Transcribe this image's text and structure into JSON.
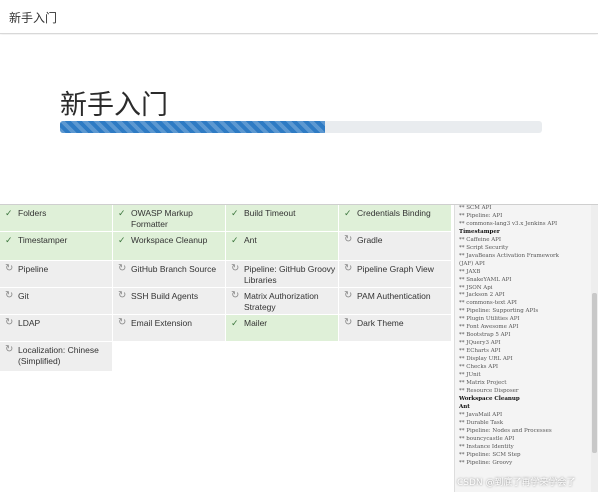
{
  "window": {
    "title": "新手入门"
  },
  "hero": {
    "title": "新手入门",
    "progress": 0.55
  },
  "plugins": [
    {
      "label": "Folders",
      "status": "installed",
      "icon": "check-icon"
    },
    {
      "label": "OWASP Markup Formatter",
      "status": "installed",
      "icon": "check-icon"
    },
    {
      "label": "Build Timeout",
      "status": "installed",
      "icon": "check-icon"
    },
    {
      "label": "Credentials Binding",
      "status": "installed",
      "icon": "check-icon"
    },
    {
      "label": "Timestamper",
      "status": "installed",
      "icon": "check-icon"
    },
    {
      "label": "Workspace Cleanup",
      "status": "installed",
      "icon": "check-icon"
    },
    {
      "label": "Ant",
      "status": "installed",
      "icon": "check-icon"
    },
    {
      "label": "Gradle",
      "status": "pending",
      "icon": "refresh-icon"
    },
    {
      "label": "Pipeline",
      "status": "pending",
      "icon": "refresh-icon"
    },
    {
      "label": "GitHub Branch Source",
      "status": "pending",
      "icon": "refresh-icon"
    },
    {
      "label": "Pipeline: GitHub Groovy Libraries",
      "status": "pending",
      "icon": "refresh-icon"
    },
    {
      "label": "Pipeline Graph View",
      "status": "pending",
      "icon": "refresh-icon"
    },
    {
      "label": "Git",
      "status": "pending",
      "icon": "refresh-icon"
    },
    {
      "label": "SSH Build Agents",
      "status": "pending",
      "icon": "refresh-icon"
    },
    {
      "label": "Matrix Authorization Strategy",
      "status": "pending",
      "icon": "refresh-icon"
    },
    {
      "label": "PAM Authentication",
      "status": "pending",
      "icon": "refresh-icon"
    },
    {
      "label": "LDAP",
      "status": "pending",
      "icon": "refresh-icon"
    },
    {
      "label": "Email Extension",
      "status": "pending",
      "icon": "refresh-icon"
    },
    {
      "label": "Mailer",
      "status": "installed",
      "icon": "check-icon"
    },
    {
      "label": "Dark Theme",
      "status": "pending",
      "icon": "refresh-icon"
    },
    {
      "label": "Localization: Chinese (Simplified)",
      "status": "pending",
      "icon": "refresh-icon"
    }
  ],
  "log": [
    {
      "text": "** SCM API",
      "head": false
    },
    {
      "text": "** Pipeline: API",
      "head": false
    },
    {
      "text": "** commons-lang3 v3.x Jenkins API",
      "head": false
    },
    {
      "text": "Timestamper",
      "head": true
    },
    {
      "text": "** Caffeine API",
      "head": false
    },
    {
      "text": "** Script Security",
      "head": false
    },
    {
      "text": "** JavaBeans Activation Framework",
      "head": false
    },
    {
      "text": "(JAF) API",
      "head": false
    },
    {
      "text": "** JAXB",
      "head": false
    },
    {
      "text": "** SnakeYAML API",
      "head": false
    },
    {
      "text": "** JSON Api",
      "head": false
    },
    {
      "text": "** Jackson 2 API",
      "head": false
    },
    {
      "text": "** commons-text API",
      "head": false
    },
    {
      "text": "** Pipeline: Supporting APIs",
      "head": false
    },
    {
      "text": "** Plugin Utilities API",
      "head": false
    },
    {
      "text": "** Font Awesome API",
      "head": false
    },
    {
      "text": "** Bootstrap 5 API",
      "head": false
    },
    {
      "text": "** JQuery3 API",
      "head": false
    },
    {
      "text": "** ECharts API",
      "head": false
    },
    {
      "text": "** Display URL API",
      "head": false
    },
    {
      "text": "** Checks API",
      "head": false
    },
    {
      "text": "** JUnit",
      "head": false
    },
    {
      "text": "** Matrix Project",
      "head": false
    },
    {
      "text": "** Resource Disposer",
      "head": false
    },
    {
      "text": "Workspace Cleanup",
      "head": true
    },
    {
      "text": "Ant",
      "head": true
    },
    {
      "text": "** JavaMail API",
      "head": false
    },
    {
      "text": "** Durable Task",
      "head": false
    },
    {
      "text": "** Pipeline: Nodes and Processes",
      "head": false
    },
    {
      "text": "** bouncycastle API",
      "head": false
    },
    {
      "text": "** Instance Identity",
      "head": false
    },
    {
      "text": "** Pipeline: SCM Step",
      "head": false
    },
    {
      "text": "** Pipeline: Groovy",
      "head": false
    }
  ],
  "watermark": "CSDN @到底了再学来学会了",
  "colors": {
    "installed": "#dff0d8",
    "pending": "#eeeeee",
    "progress": "#2e7bc4"
  }
}
